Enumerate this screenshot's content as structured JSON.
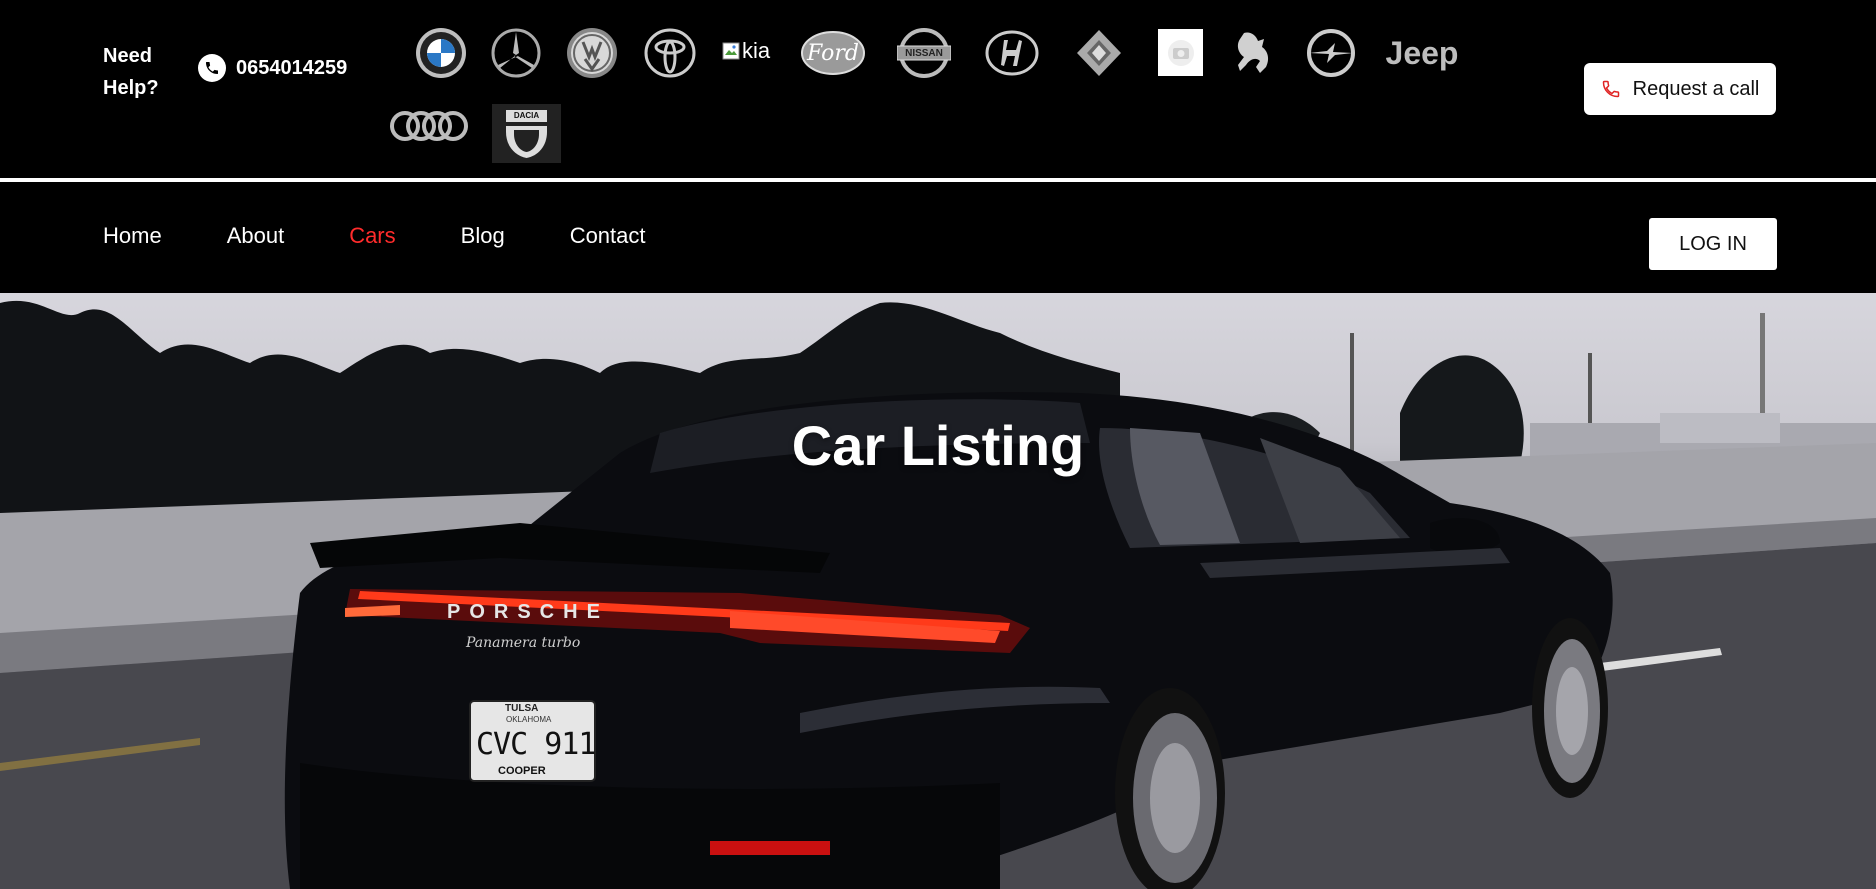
{
  "header": {
    "need_help": "Need Help?",
    "phone_number": "0654014259",
    "phone_icon": "phone-icon",
    "request_call_label": "Request a call",
    "request_call_icon_color": "#e02424"
  },
  "brands": {
    "kia_alt": "kia",
    "ford_label": "Ford",
    "nissan_label": "NISSAN",
    "jeep_label": "Jeep",
    "dacia_label": "DACIA"
  },
  "nav": {
    "items": [
      {
        "label": "Home",
        "active": false
      },
      {
        "label": "About",
        "active": false
      },
      {
        "label": "Cars",
        "active": true
      },
      {
        "label": "Blog",
        "active": false
      },
      {
        "label": "Contact",
        "active": false
      }
    ],
    "active_color": "#ff2b2b",
    "login_label": "LOG IN"
  },
  "hero": {
    "title": "Car Listing",
    "car_brand_text": "PORSCHE",
    "car_model_text": "Panamera turbo",
    "plate_top": "TULSA",
    "plate_state": "OKLAHOMA",
    "plate_number": "CVC 911",
    "plate_bottom": "COOPER"
  }
}
